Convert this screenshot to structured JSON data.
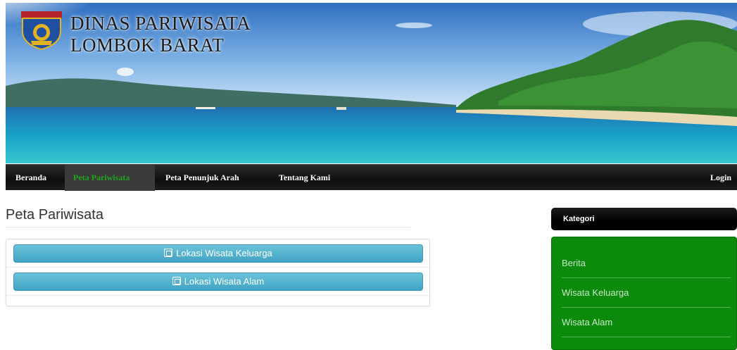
{
  "header": {
    "title_line1": "DINAS PARIWISATA",
    "title_line2": "LOMBOK BARAT",
    "logo_icon": "regency-emblem-icon",
    "logo_text": "LOMBOK BARAT"
  },
  "navbar": {
    "items": [
      {
        "label": "Beranda",
        "active": false
      },
      {
        "label": "Peta Pariwisata",
        "active": true
      },
      {
        "label": "Peta Penunjuk Arah",
        "active": false
      },
      {
        "label": "Tentang Kami",
        "active": false
      }
    ],
    "login_label": "Login"
  },
  "main": {
    "title": "Peta Pariwisata",
    "buttons": [
      {
        "label": "Lokasi Wisata Keluarga",
        "icon": "list-icon"
      },
      {
        "label": "Lokasi Wisata Alam",
        "icon": "list-icon"
      }
    ]
  },
  "sidebar": {
    "header": "Kategori",
    "items": [
      {
        "label": "Berita"
      },
      {
        "label": "Wisata Keluarga"
      },
      {
        "label": "Wisata Alam"
      }
    ]
  },
  "colors": {
    "nav_active_text": "#1ea51e",
    "button_bg": "#4fb0cc",
    "sidebar_bg": "#0b8a0b",
    "sidebar_header_bg": "#000000"
  }
}
